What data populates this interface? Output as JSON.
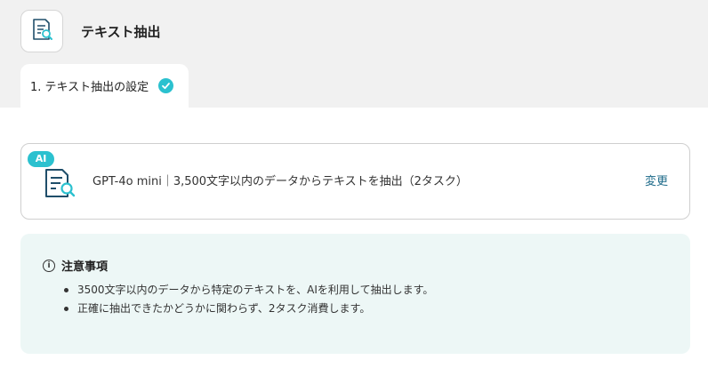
{
  "header": {
    "title": "テキスト抽出",
    "icon": "document-search-icon"
  },
  "tab": {
    "label": "1. テキスト抽出の設定",
    "status_icon": "check-circle-icon",
    "accent": "#2bc1cf"
  },
  "action_card": {
    "badge": "AI",
    "icon": "document-search-icon",
    "description": "GPT-4o mini｜3,500文字以内のデータからテキストを抽出（2タスク）",
    "change_label": "変更",
    "link_color": "#1e6b8a"
  },
  "notice": {
    "icon": "info-icon",
    "title": "注意事項",
    "items": [
      "3500文字以内のデータから特定のテキストを、AIを利用して抽出します。",
      "正確に抽出できたかどうかに関わらず、2タスク消費します。"
    ],
    "background": "#edf7f6"
  }
}
